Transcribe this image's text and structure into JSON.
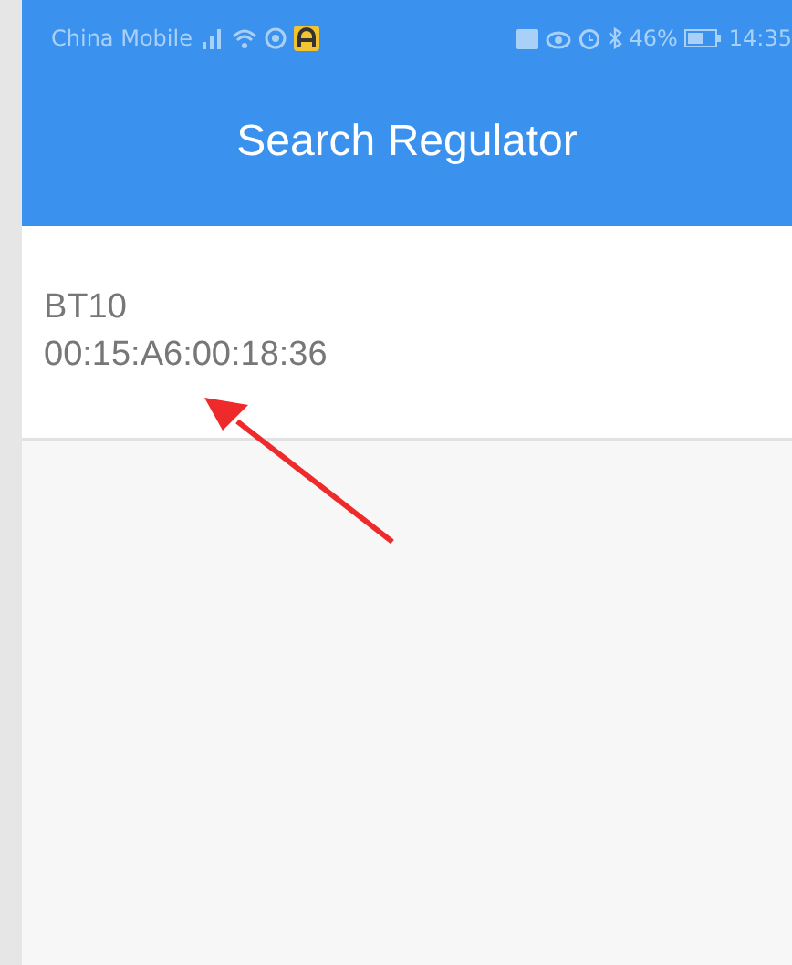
{
  "status_bar": {
    "carrier": "China Mobile",
    "battery": "46%",
    "time": "14:35"
  },
  "app_bar": {
    "title": "Search Regulator"
  },
  "devices": [
    {
      "name": "BT10",
      "address": "00:15:A6:00:18:36"
    }
  ]
}
